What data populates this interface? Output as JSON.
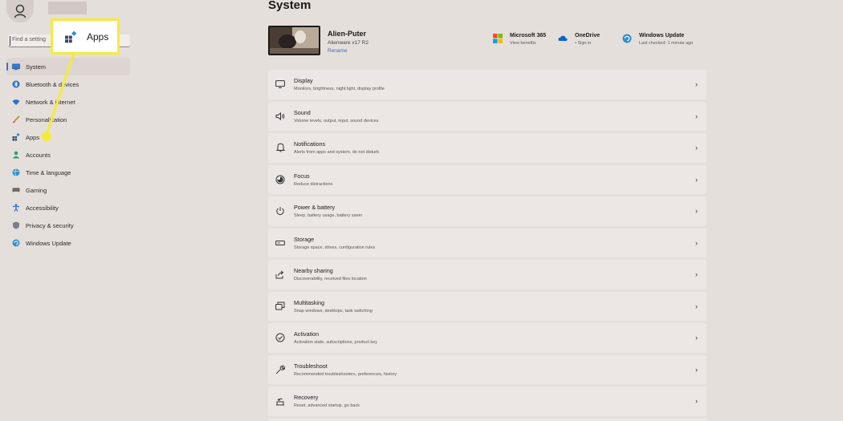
{
  "sidebar": {
    "search_placeholder": "Find a setting",
    "items": [
      {
        "label": "System",
        "icon": "system-icon",
        "selected": true
      },
      {
        "label": "Bluetooth & devices",
        "icon": "bluetooth-icon"
      },
      {
        "label": "Network & internet",
        "icon": "wifi-icon"
      },
      {
        "label": "Personalization",
        "icon": "brush-icon"
      },
      {
        "label": "Apps",
        "icon": "apps-icon"
      },
      {
        "label": "Accounts",
        "icon": "accounts-icon"
      },
      {
        "label": "Time & language",
        "icon": "globe-icon"
      },
      {
        "label": "Gaming",
        "icon": "gamepad-icon"
      },
      {
        "label": "Accessibility",
        "icon": "accessibility-icon"
      },
      {
        "label": "Privacy & security",
        "icon": "shield-icon"
      },
      {
        "label": "Windows Update",
        "icon": "update-icon"
      }
    ]
  },
  "callout": {
    "label": "Apps",
    "color": "#f5ea3c"
  },
  "main": {
    "title": "System",
    "device": {
      "name": "Alien-Puter",
      "model": "Alienware x17 R2",
      "rename": "Rename"
    },
    "quick_links": [
      {
        "title": "Microsoft 365",
        "sub": "View benefits",
        "icon": "microsoft-logo-icon"
      },
      {
        "title": "OneDrive",
        "sub": "• Sign in",
        "icon": "cloud-icon"
      },
      {
        "title": "Windows Update",
        "sub": "Last checked: 1 minute ago",
        "icon": "update-icon"
      }
    ],
    "settings": [
      {
        "title": "Display",
        "desc": "Monitors, brightness, night light, display profile",
        "icon": "display-icon"
      },
      {
        "title": "Sound",
        "desc": "Volume levels, output, input, sound devices",
        "icon": "speaker-icon"
      },
      {
        "title": "Notifications",
        "desc": "Alerts from apps and system, do not disturb",
        "icon": "bell-icon"
      },
      {
        "title": "Focus",
        "desc": "Reduce distractions",
        "icon": "focus-icon"
      },
      {
        "title": "Power & battery",
        "desc": "Sleep, battery usage, battery saver",
        "icon": "power-icon"
      },
      {
        "title": "Storage",
        "desc": "Storage space, drives, configuration rules",
        "icon": "storage-icon"
      },
      {
        "title": "Nearby sharing",
        "desc": "Discoverability, received files location",
        "icon": "share-icon"
      },
      {
        "title": "Multitasking",
        "desc": "Snap windows, desktops, task switching",
        "icon": "multitask-icon"
      },
      {
        "title": "Activation",
        "desc": "Activation state, subscriptions, product key",
        "icon": "check-circle-icon"
      },
      {
        "title": "Troubleshoot",
        "desc": "Recommended troubleshooters, preferences, history",
        "icon": "wrench-icon"
      },
      {
        "title": "Recovery",
        "desc": "Reset, advanced startup, go back",
        "icon": "recovery-icon"
      }
    ]
  },
  "colors": {
    "accent": "#3a6fd0",
    "background": "#e5dfdb",
    "card": "#ece7e4",
    "highlight": "#f5ea3c"
  }
}
